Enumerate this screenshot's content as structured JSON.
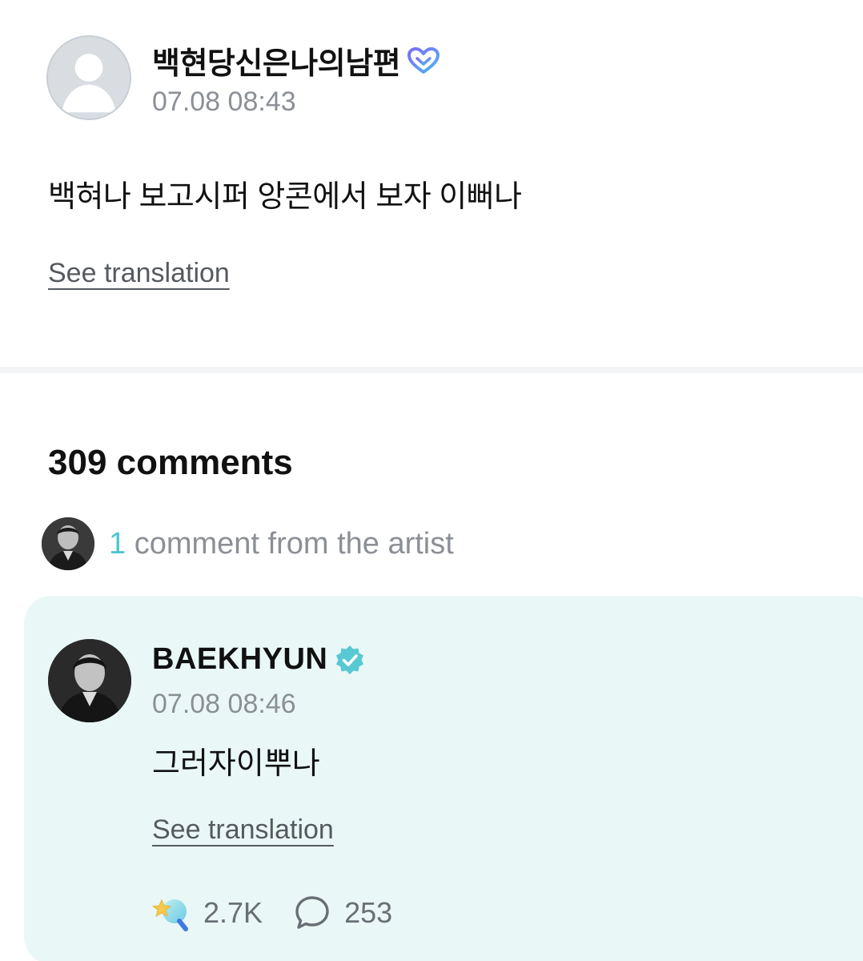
{
  "post": {
    "author": "백현당신은나의남편",
    "author_badge_icon": "heart-membership-icon",
    "timestamp": "07.08 08:43",
    "body": "백혀나 보고시퍼 앙콘에서 보자 이뻐나",
    "translate_label": "See translation"
  },
  "comments": {
    "title": "309 comments",
    "artist_summary": {
      "count": "1",
      "text": " comment from the artist"
    }
  },
  "artist_comment": {
    "author": "BAEKHYUN",
    "author_badge_icon": "verified-check-icon",
    "timestamp": "07.08 08:46",
    "body": "그러자이뿌나",
    "translate_label": "See translation",
    "stats": {
      "likes": "2.7K",
      "replies": "253"
    }
  },
  "colors": {
    "accent": "#4fc6cf",
    "card_background": "#e9f8f7",
    "muted_text": "#8b8f96"
  }
}
